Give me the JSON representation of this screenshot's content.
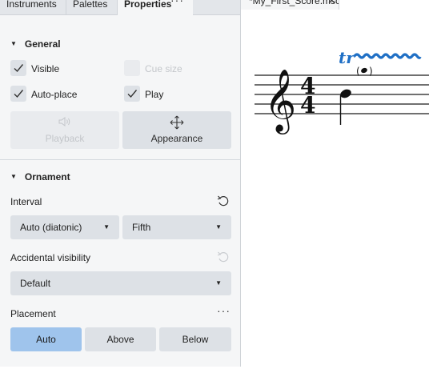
{
  "tabs": [
    "Instruments",
    "Palettes",
    "Properties"
  ],
  "tabs_menu_icon": "more-horizontal-icon",
  "general": {
    "title": "General",
    "visible_label": "Visible",
    "visible_checked": true,
    "cue_size_label": "Cue size",
    "cue_size_checked": false,
    "auto_place_label": "Auto-place",
    "auto_place_checked": true,
    "play_label": "Play",
    "play_checked": true,
    "playback_label": "Playback",
    "appearance_label": "Appearance"
  },
  "ornament": {
    "title": "Ornament",
    "interval_label": "Interval",
    "interval_type_value": "Auto (diatonic)",
    "interval_value": "Fifth",
    "accidental_visibility_label": "Accidental visibility",
    "accidental_visibility_value": "Default",
    "placement_label": "Placement",
    "placement_options": [
      "Auto",
      "Above",
      "Below"
    ],
    "placement_selected": "Auto"
  },
  "score": {
    "tab_title": "*My_First_Score.mscx",
    "time_signature_top": "4",
    "time_signature_bottom": "4",
    "trill_text": "tr",
    "accent_color": "#1f6fc5"
  }
}
